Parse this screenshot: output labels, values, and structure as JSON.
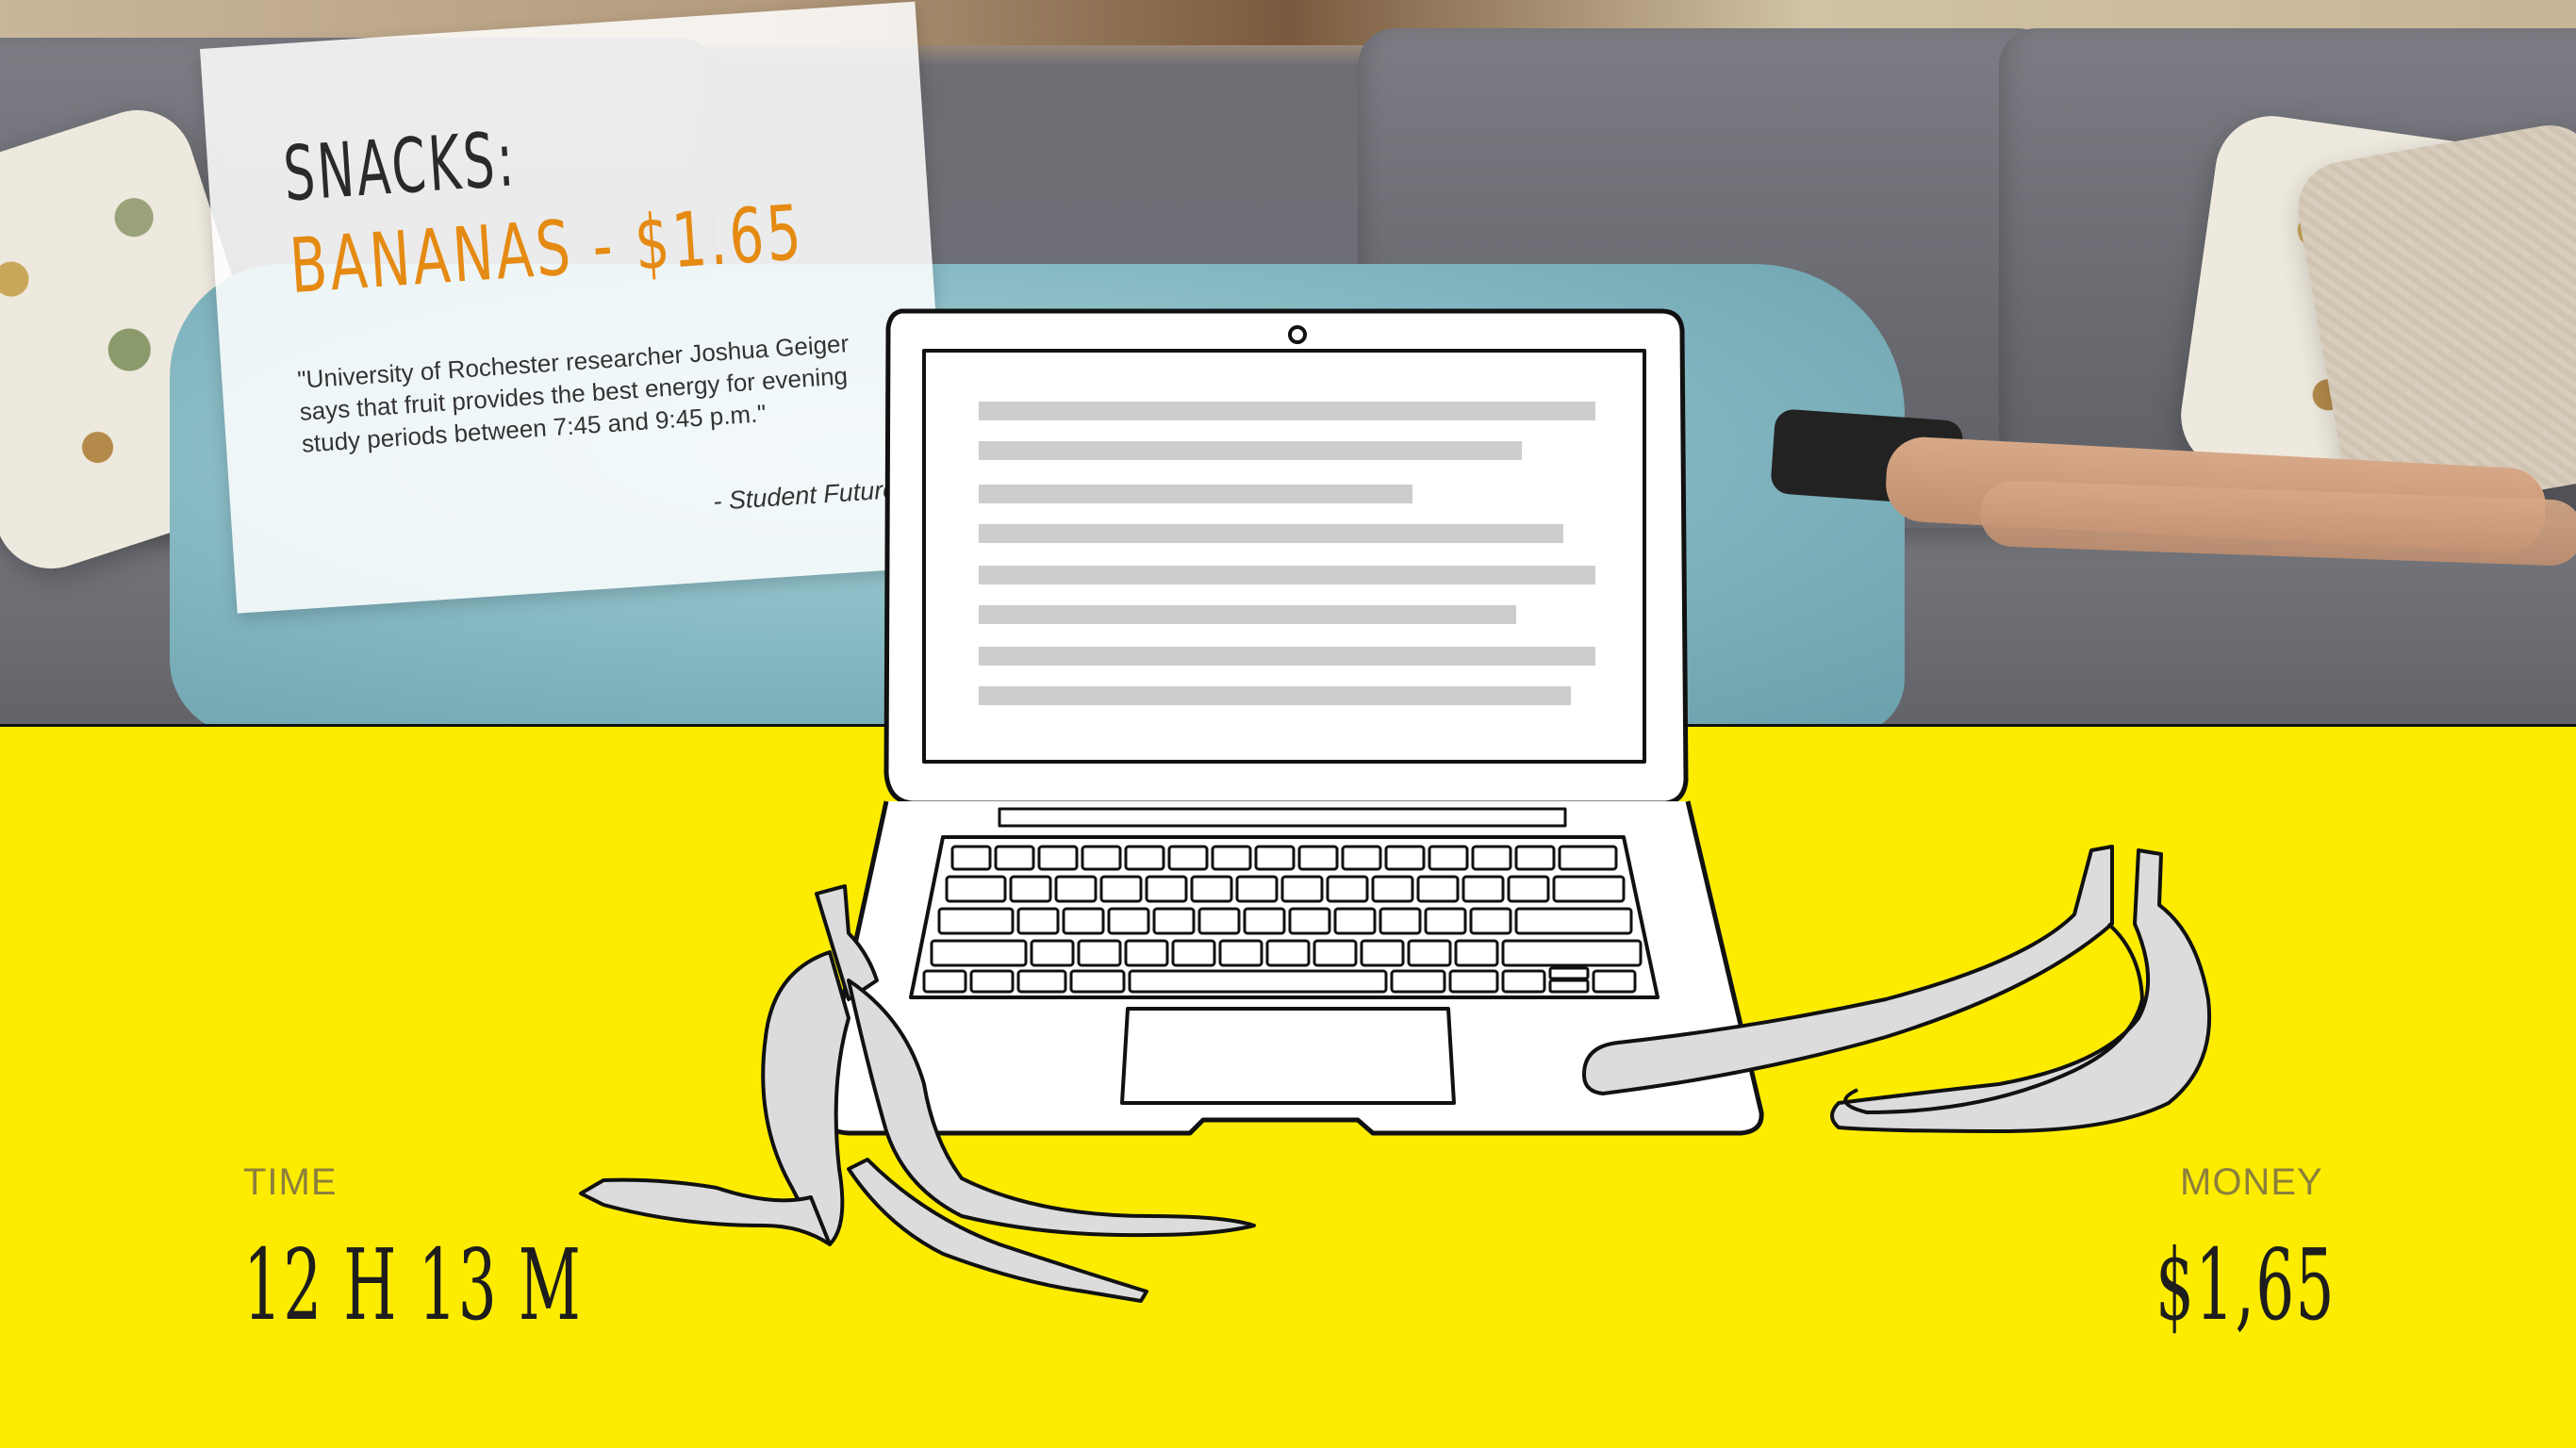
{
  "card": {
    "heading": "SNACKS:",
    "highlight": "BANANAS - $1.65",
    "quote": "\"University of Rochester researcher Joshua Geiger says that fruit provides the best energy for evening study periods between 7:45 and 9:45 p.m.\"",
    "source": "- Student Futures"
  },
  "stats": {
    "time_label": "TIME",
    "time_value": "12 H 13 M",
    "money_label": "MONEY",
    "money_value": "$1,65"
  },
  "colors": {
    "panel_yellow": "#fdec00",
    "highlight_orange": "#e58a12",
    "screen_text_bar": "#cdcdd0",
    "banana_fill": "#dcdcdc"
  },
  "icons": [
    "laptop-illustration",
    "banana-peel-illustration",
    "banana-bunch-illustration"
  ]
}
